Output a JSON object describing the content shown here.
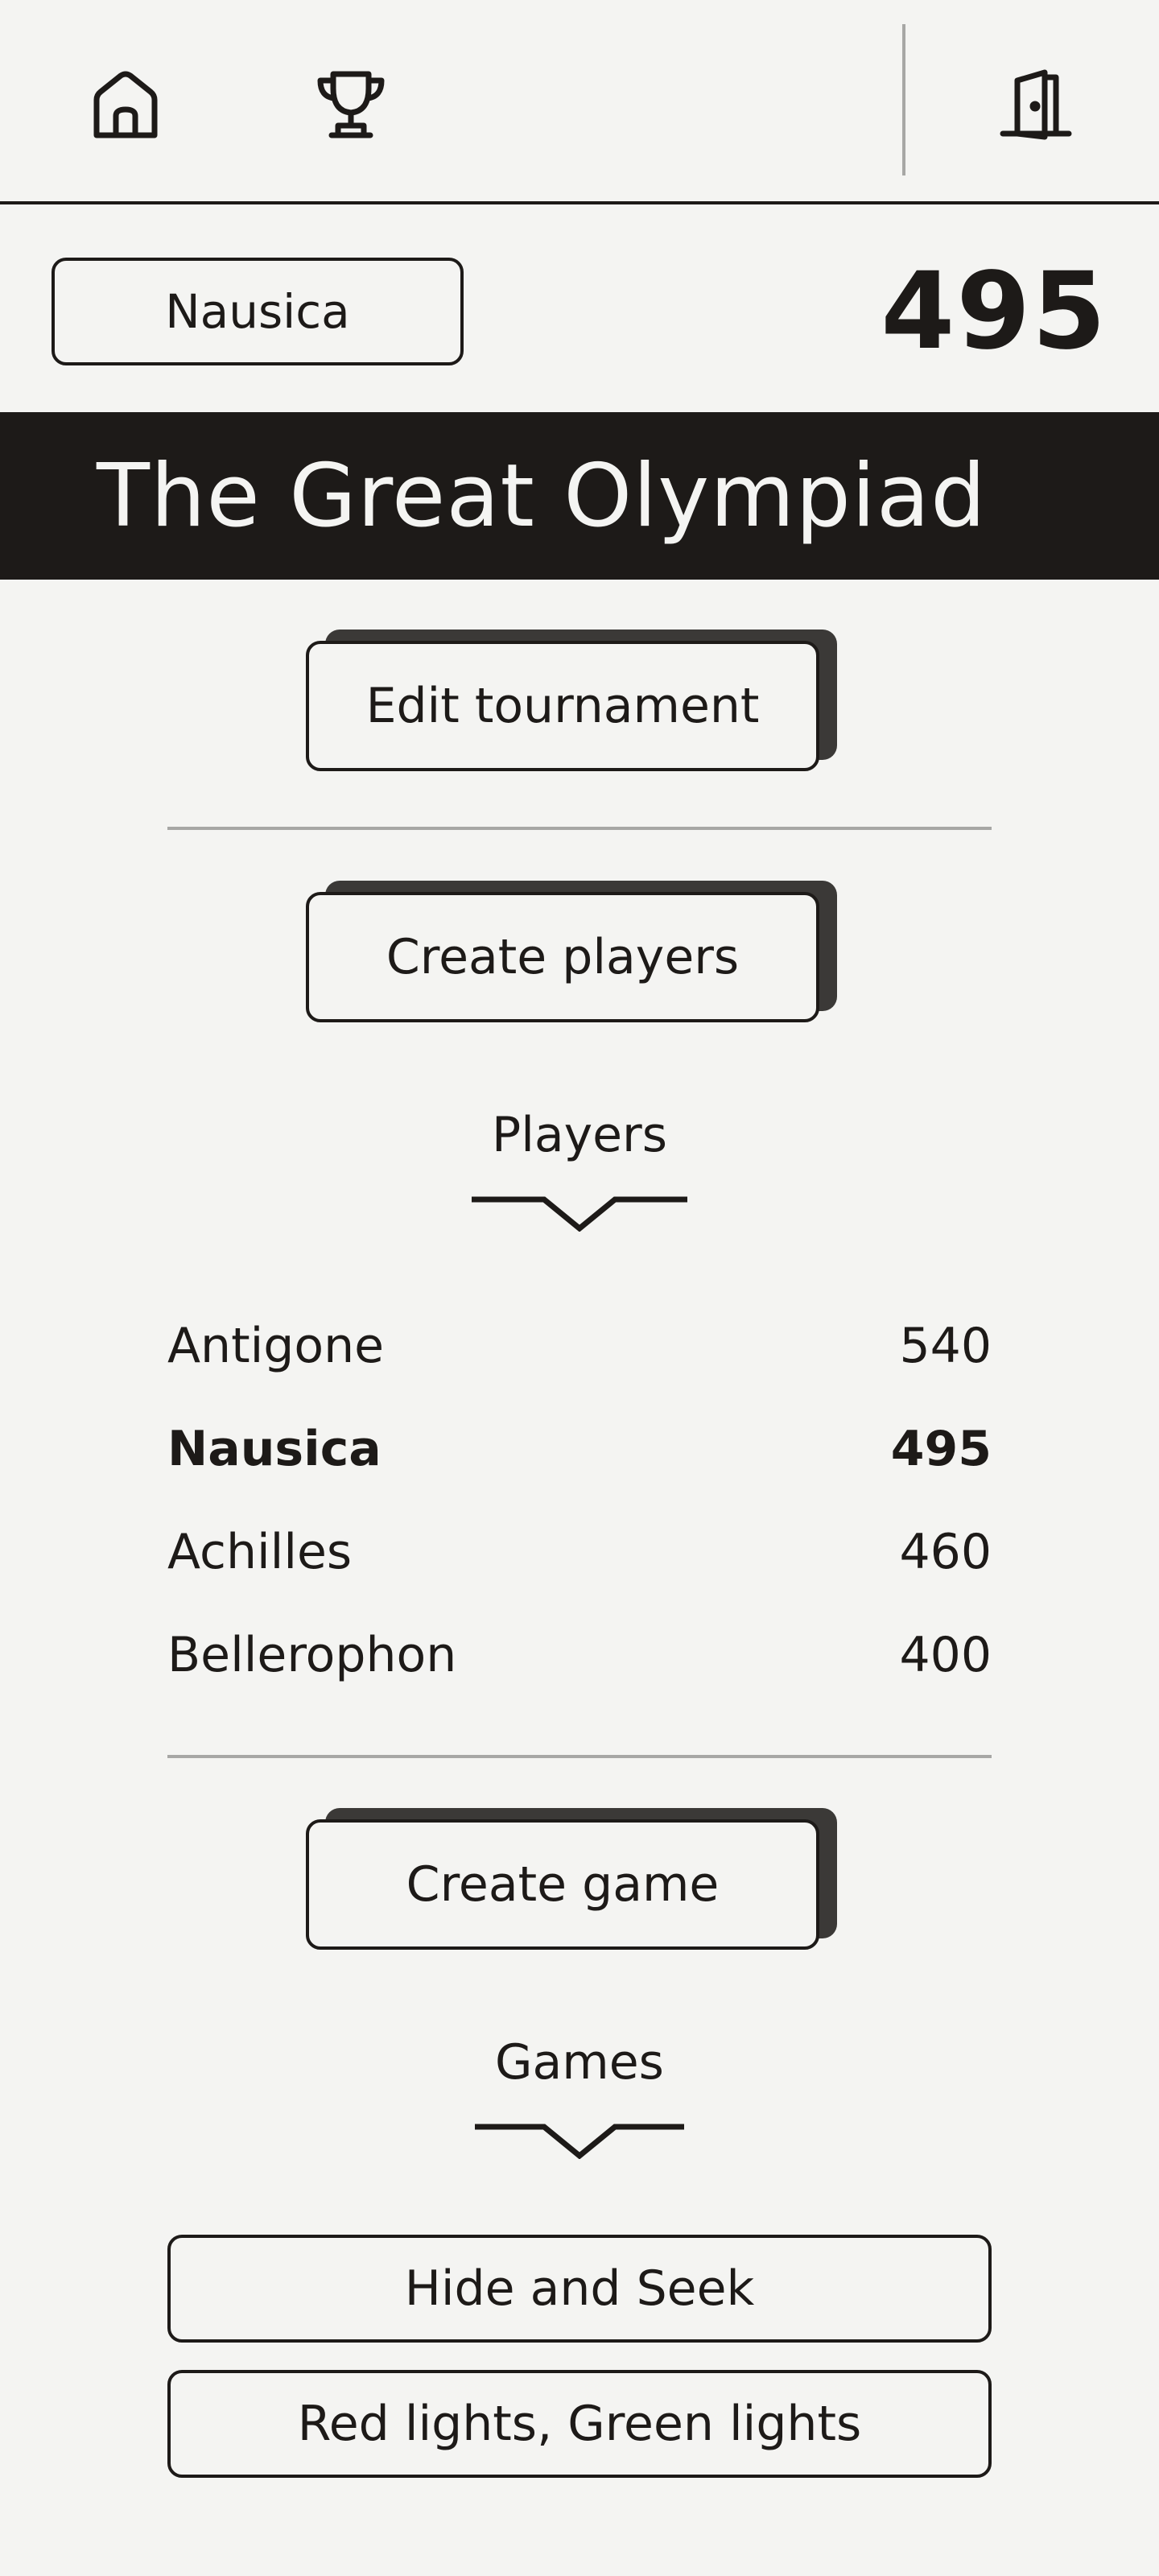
{
  "user": {
    "name": "Nausica",
    "score": "495"
  },
  "tournament": {
    "title": "The Great Olympiad"
  },
  "actions": {
    "edit_tournament": "Edit tournament",
    "create_players": "Create players",
    "create_game": "Create game"
  },
  "players_section": {
    "title": "Players",
    "players": [
      {
        "name": "Antigone",
        "score": "540"
      },
      {
        "name": "Nausica",
        "score": "495"
      },
      {
        "name": "Achilles",
        "score": "460"
      },
      {
        "name": "Bellerophon",
        "score": "400"
      }
    ]
  },
  "games_section": {
    "title": "Games",
    "games": [
      {
        "name": "Hide and Seek"
      },
      {
        "name": "Red lights, Green lights"
      }
    ]
  },
  "icons": {
    "home": "home-icon",
    "trophy": "trophy-icon",
    "exit": "door-exit-icon",
    "expand": "chevron-down-icon"
  },
  "colors": {
    "background": "#f4f4f2",
    "ink": "#1d1a18",
    "divider": "#a7a7a5",
    "button_shadow": "#3b3937"
  }
}
